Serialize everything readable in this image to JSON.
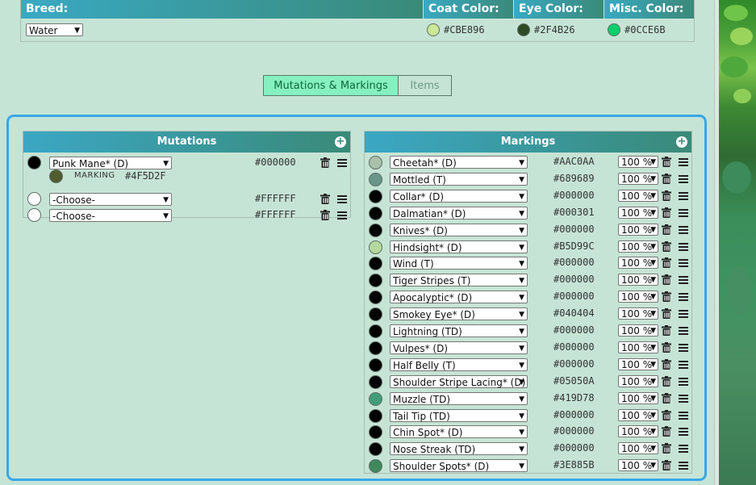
{
  "breed": {
    "headers": {
      "breed": "Breed:",
      "coat": "Coat Color:",
      "eye": "Eye Color:",
      "misc": "Misc. Color:"
    },
    "selected": "Water",
    "coat_hex": "#CBE896",
    "eye_hex": "#2F4B26",
    "misc_hex": "#0CCE6B"
  },
  "tabs": [
    {
      "label": "Mutations & Markings",
      "active": true
    },
    {
      "label": "Items",
      "active": false
    }
  ],
  "mutations": {
    "title": "Mutations",
    "rows": [
      {
        "name": "Punk Mane* (D)",
        "hex": "#000000",
        "marking_label": "MARKING",
        "marking_hex": "#4F5D2F"
      },
      {
        "name": "-Choose-",
        "hex": "#FFFFFF"
      },
      {
        "name": "-Choose-",
        "hex": "#FFFFFF"
      }
    ]
  },
  "markings": {
    "title": "Markings",
    "rows": [
      {
        "name": "Cheetah* (D)",
        "hex": "#AAC0AA",
        "pct": "100 %"
      },
      {
        "name": "Mottled (T)",
        "hex": "#689689",
        "pct": "100 %"
      },
      {
        "name": "Collar* (D)",
        "hex": "#000000",
        "pct": "100 %"
      },
      {
        "name": "Dalmatian* (D)",
        "hex": "#000301",
        "pct": "100 %"
      },
      {
        "name": "Knives* (D)",
        "hex": "#000000",
        "pct": "100 %"
      },
      {
        "name": "Hindsight* (D)",
        "hex": "#B5D99C",
        "pct": "100 %"
      },
      {
        "name": "Wind (T)",
        "hex": "#000000",
        "pct": "100 %"
      },
      {
        "name": "Tiger Stripes (T)",
        "hex": "#000000",
        "pct": "100 %"
      },
      {
        "name": "Apocalyptic* (D)",
        "hex": "#000000",
        "pct": "100 %"
      },
      {
        "name": "Smokey Eye* (D)",
        "hex": "#040404",
        "pct": "100 %"
      },
      {
        "name": "Lightning (TD)",
        "hex": "#000000",
        "pct": "100 %"
      },
      {
        "name": "Vulpes* (D)",
        "hex": "#000000",
        "pct": "100 %"
      },
      {
        "name": "Half Belly (T)",
        "hex": "#000000",
        "pct": "100 %"
      },
      {
        "name": "Shoulder Stripe Lacing* (D)",
        "hex": "#05050A",
        "pct": "100 %"
      },
      {
        "name": "Muzzle (TD)",
        "hex": "#419D78",
        "pct": "100 %"
      },
      {
        "name": "Tail Tip (TD)",
        "hex": "#000000",
        "pct": "100 %"
      },
      {
        "name": "Chin Spot* (D)",
        "hex": "#000000",
        "pct": "100 %"
      },
      {
        "name": "Nose Streak (TD)",
        "hex": "#000000",
        "pct": "100 %"
      },
      {
        "name": "Shoulder Spots* (D)",
        "hex": "#3E885B",
        "pct": "100 %"
      }
    ]
  },
  "colors": {
    "header_gradient_start": "#39A9C3",
    "header_gradient_end": "#3A8A78",
    "outer_border": "#38A7E8",
    "active_tab": "#86F0C0"
  }
}
